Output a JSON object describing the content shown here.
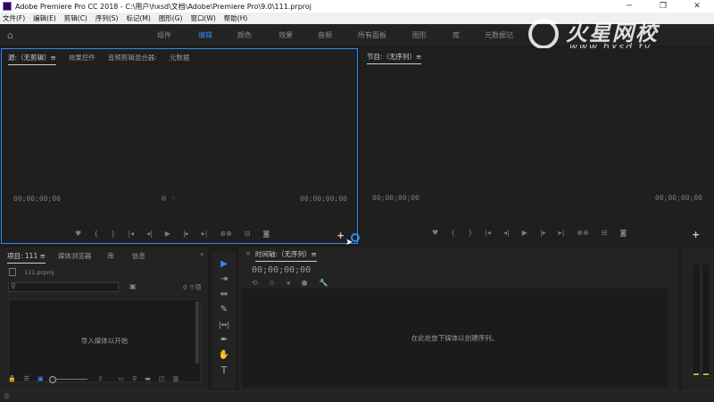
{
  "window": {
    "title": "Adobe Premiere Pro CC 2018 - C:\\用户\\hxsd\\文档\\Adobe\\Premiere Pro\\9.0\\111.prproj",
    "minimize": "─",
    "maximize": "❐",
    "close": "✕"
  },
  "menu": [
    "文件(F)",
    "编辑(E)",
    "剪辑(C)",
    "序列(S)",
    "标记(M)",
    "图形(G)",
    "窗口(W)",
    "帮助(H)"
  ],
  "workspaces": {
    "items": [
      "组件",
      "编辑",
      "颜色",
      "效果",
      "音频",
      "所有面板",
      "图形",
      "库",
      "元数据记"
    ],
    "active_index": 1,
    "more": "»"
  },
  "watermark": {
    "main": "火星网校",
    "sub": "www.hxsd.tv"
  },
  "source_panel": {
    "tabs": [
      "源:（无剪辑）≡",
      "效果控件",
      "音频剪辑混合器:",
      "元数据"
    ],
    "active_tab": 0,
    "timecode_left": "00;00;00;00",
    "timecode_right": "00;00;00;00",
    "controls": [
      "♥",
      "{",
      "}",
      "|◂",
      "◂|",
      "▶",
      "|▸",
      "▸|",
      "⊕⊕",
      "⊟",
      "◙"
    ],
    "add_button": "+"
  },
  "program_panel": {
    "tabs": [
      "节目:（无序列）≡"
    ],
    "timecode_left": "00;00;00;00",
    "timecode_right": "00;00;00;00",
    "controls": [
      "♥",
      "{",
      "}",
      "|◂",
      "◂|",
      "▶",
      "|▸",
      "▸|",
      "⊕⊕",
      "⊟",
      "◙"
    ],
    "add_button": "+"
  },
  "project_panel": {
    "tabs": [
      "项目: 111 ≡",
      "媒体浏览器",
      "库",
      "信息"
    ],
    "more": "»",
    "file_name": "111.prproj",
    "item_count": "0 个项",
    "drop_text": "导入媒体以开始",
    "tool_icons": [
      "🔒",
      "☰",
      "▣"
    ]
  },
  "tools": [
    "▶",
    "⇥",
    "⇔",
    "✎",
    "|↔|",
    "✒",
    "✋",
    "T"
  ],
  "timeline_panel": {
    "tab": "时间轴:（无序列）≡",
    "close": "×",
    "timecode": "00;00;00;00",
    "icons": [
      "⟲",
      "∩",
      "◂",
      "●",
      "🔧"
    ],
    "drop_text": "在此处放下媒体以创建序列。"
  },
  "colors": {
    "accent": "#2d8ceb",
    "panel_bg": "#232323",
    "app_bg": "#1d1d1d",
    "meter_peak": "#c9b22a"
  }
}
